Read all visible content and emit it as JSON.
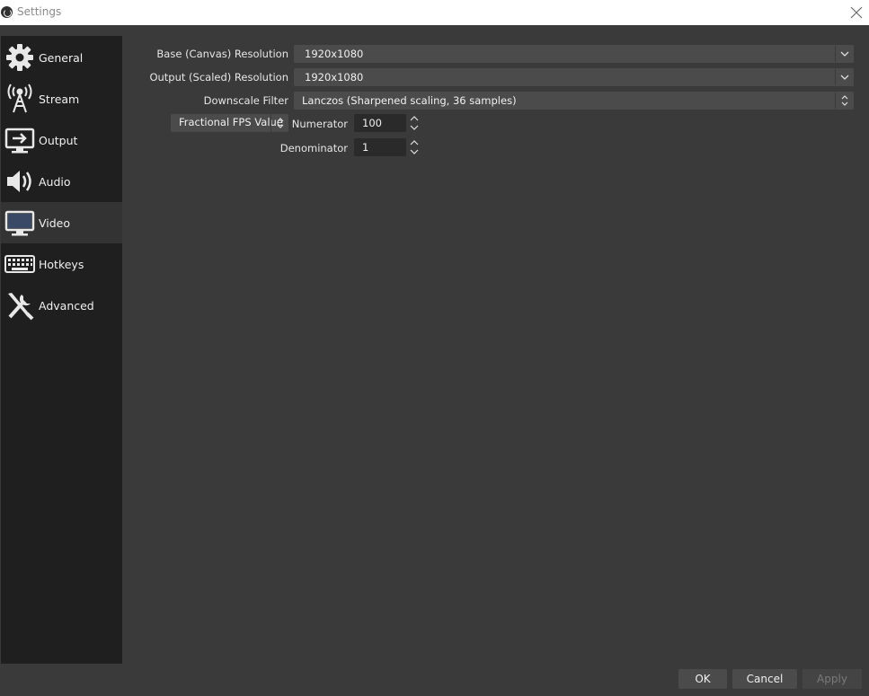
{
  "window": {
    "title": "Settings"
  },
  "sidebar": {
    "items": [
      {
        "label": "General",
        "icon": "gear-icon"
      },
      {
        "label": "Stream",
        "icon": "antenna-icon"
      },
      {
        "label": "Output",
        "icon": "output-icon"
      },
      {
        "label": "Audio",
        "icon": "speaker-icon"
      },
      {
        "label": "Video",
        "icon": "monitor-icon",
        "selected": true
      },
      {
        "label": "Hotkeys",
        "icon": "keyboard-icon"
      },
      {
        "label": "Advanced",
        "icon": "tools-icon"
      }
    ]
  },
  "video": {
    "base_resolution": {
      "label": "Base (Canvas) Resolution",
      "value": "1920x1080"
    },
    "output_resolution": {
      "label": "Output (Scaled) Resolution",
      "value": "1920x1080"
    },
    "downscale_filter": {
      "label": "Downscale Filter",
      "value": "Lanczos (Sharpened scaling, 36 samples)"
    },
    "fps_type": {
      "value": "Fractional FPS Value"
    },
    "numerator": {
      "label": "Numerator",
      "value": "100"
    },
    "denominator": {
      "label": "Denominator",
      "value": "1"
    }
  },
  "buttons": {
    "ok": "OK",
    "cancel": "Cancel",
    "apply": "Apply"
  },
  "colors": {
    "background": "#3a3a3a",
    "sidebar": "#1f1f1f",
    "selected": "#333333",
    "control": "#4b4b4b"
  }
}
